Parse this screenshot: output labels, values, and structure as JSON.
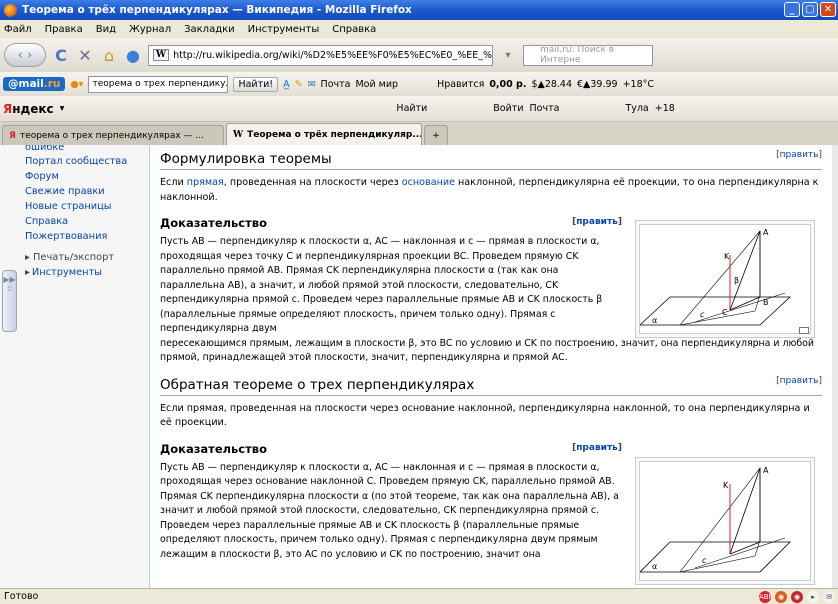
{
  "window": {
    "title": "Теорема о трёх перпендикулярах — Википедия - Mozilla Firefox",
    "min": "_",
    "max": "▢",
    "close": "✕"
  },
  "menu": [
    "Файл",
    "Правка",
    "Вид",
    "Журнал",
    "Закладки",
    "Инструменты",
    "Справка"
  ],
  "nav": {
    "back_fwd": "‹ ›",
    "reload": "C",
    "stop": "✕",
    "home": "⌂",
    "wbadge": "W",
    "url": "http://ru.wikipedia.org/wiki/%D2%E5%EE%F0%E5%EC%E0_%EE_%F2%F0%B",
    "search_placeholder": "mail.ru: Поиск в Интерне"
  },
  "mailbar": {
    "logo_a": "@mail",
    "logo_b": ".ru",
    "query": "теорема о трех перпендикуля",
    "find": "Найти!",
    "mail": "Почта",
    "myworld": "Мой мир",
    "like": "Нравится",
    "money": "0,00 р.",
    "usd": "$▲28.44",
    "eur": "€▲39.99",
    "weather": "+18°C"
  },
  "yabar": {
    "logo_a": "Я",
    "logo_b": "ндекс",
    "find": "Найти",
    "login": "Войти",
    "mail": "Почта",
    "city": "Тула",
    "temp": "+18"
  },
  "tabs": [
    {
      "label": "теорема о трех перпендикулярах — ..."
    },
    {
      "label": "Теорема о трёх перпендикуляр..."
    }
  ],
  "sidebar": {
    "items": [
      "ошибке",
      "Портал сообщества",
      "Форум",
      "Свежие правки",
      "Новые страницы",
      "Справка",
      "Пожертвования"
    ],
    "print": "Печать/экспорт",
    "tools": "Инструменты"
  },
  "content": {
    "edit": "править",
    "s1_title": "Формулировка теоремы",
    "s1_text_a": "Если ",
    "s1_link1": "прямая",
    "s1_text_b": ", проведенная на плоскости через ",
    "s1_link2": "основание",
    "s1_text_c": " наклонной, перпендикулярна её проекции, то она перпендикулярна к наклонной.",
    "proof_title": "Доказательство",
    "p1": "Пусть AB — перпендикуляр к плоскости α, AC — наклонная и c — прямая в плоскости α, проходящая через точку C и перпендикулярная проекции BC. Проведем прямую CK параллельно прямой AB. Прямая CK перпендикулярна плоскости α (так как она параллельна AB), а значит, и любой прямой этой плоскости, следовательно, CK перпендикулярна прямой c. Проведем через параллельные прямые AB и CK плоскость β (параллельные прямые определяют плоскость, причем только одну). Прямая c перпендикулярна двум",
    "p1_tail": "пересекающимся прямым, лежащим в плоскости β, это BC по условию и CK по построению, значит, она перпендикулярна и любой прямой, принадлежащей этой плоскости, значит, перпендикулярна и прямой AC.",
    "s2_title": "Обратная теореме о трех перпендикулярах",
    "s2_text": "Если прямая, проведенная на плоскости через основание наклонной, перпендикулярна наклонной, то она перпендикулярна и её проекции.",
    "p2": "Пусть AB — перпендикуляр к плоскости α, AC — наклонная и c — прямая в плоскости α, проходящая через основание наклонной C. Проведем прямую CK, параллельно прямой AB. Прямая CK перпендикулярна плоскости α (по этой теореме, так как она параллельна AB), а значит и любой прямой этой плоскости, следовательно, CK перпендикулярна прямой c. Проведем через параллельные прямые AB и CK плоскость β (параллельные прямые определяют плоскость, причем только одну). Прямая c перпендикулярна двум прямым лежащим в плоскости β, это AC по условию и CK по построению, значит она"
  },
  "figure": {
    "A": "A",
    "K": "K",
    "B": "B",
    "C": "C",
    "c": "c",
    "alpha": "α",
    "beta": "β"
  },
  "status": {
    "text": "Готово"
  }
}
